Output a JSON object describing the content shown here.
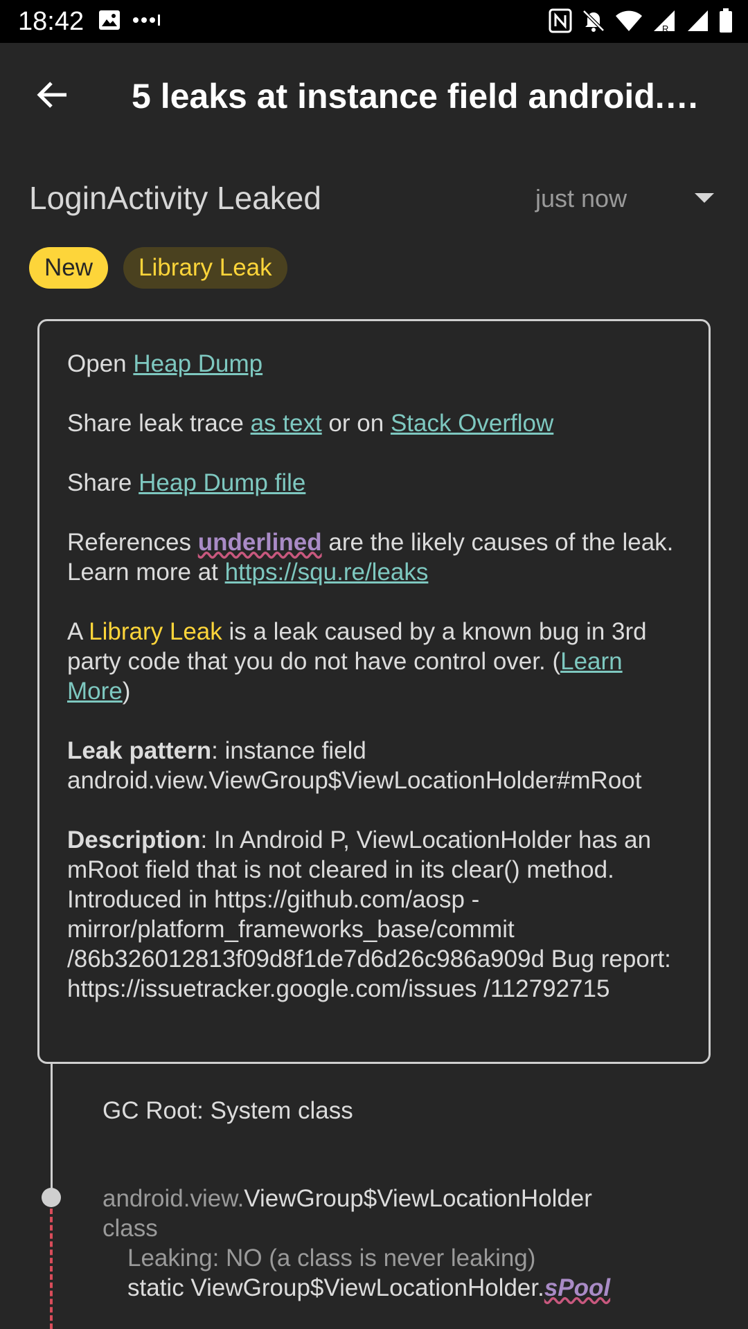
{
  "status_bar": {
    "time": "18:42"
  },
  "toolbar": {
    "title": "5 leaks at instance field android.…"
  },
  "leak_header": {
    "title": "LoginActivity Leaked",
    "time": "just now"
  },
  "chips": {
    "new": "New",
    "library_leak": "Library Leak"
  },
  "info": {
    "open_prefix": "Open ",
    "open_link": "Heap Dump",
    "share_trace_prefix": "Share leak trace ",
    "share_trace_link_text": "as text",
    "share_trace_middle": " or on ",
    "share_trace_link_so": "Stack Overflow",
    "share_file_prefix": "Share ",
    "share_file_link": "Heap Dump file",
    "references_prefix": "References ",
    "references_underlined": "underlined",
    "references_suffix": " are the likely causes of the leak. Learn more at ",
    "references_link": "https://squ.re/leaks",
    "library_prefix": "A ",
    "library_word": "Library Leak",
    "library_middle": " is a leak caused by a known bug in 3rd party code that you do not have control over. (",
    "library_link": "Learn More",
    "library_suffix": ")",
    "pattern_label": "Leak pattern",
    "pattern_text": ": instance field android.view.ViewGroup$ViewLocationHolder#mRoot",
    "description_label": "Description",
    "description_text": ": In Android P, ViewLocationHolder has an mRoot field that is not cleared in its clear() method. Introduced in https://github.com/aosp -mirror/platform_frameworks_base/commit /86b326012813f09d8f1de7d6d26c986a909d Bug report: https://issuetracker.google.com/issues /112792715"
  },
  "trace": {
    "gc_root": "GC Root: System class",
    "node_package": "android.view.",
    "node_class": "ViewGroup$ViewLocationHolder",
    "node_kind": "class",
    "node_leaking": "Leaking: NO (a class is never leaking)",
    "node_ref_prefix": "static ViewGroup$ViewLocationHolder.",
    "node_ref_field": "sPool"
  },
  "colors": {
    "background": "#262626",
    "status_bar": "#000000",
    "link": "#7ec8c0",
    "accent_yellow": "#fdd53a",
    "reference_purple": "#a98bc6",
    "leak_red": "#d84c5a"
  }
}
